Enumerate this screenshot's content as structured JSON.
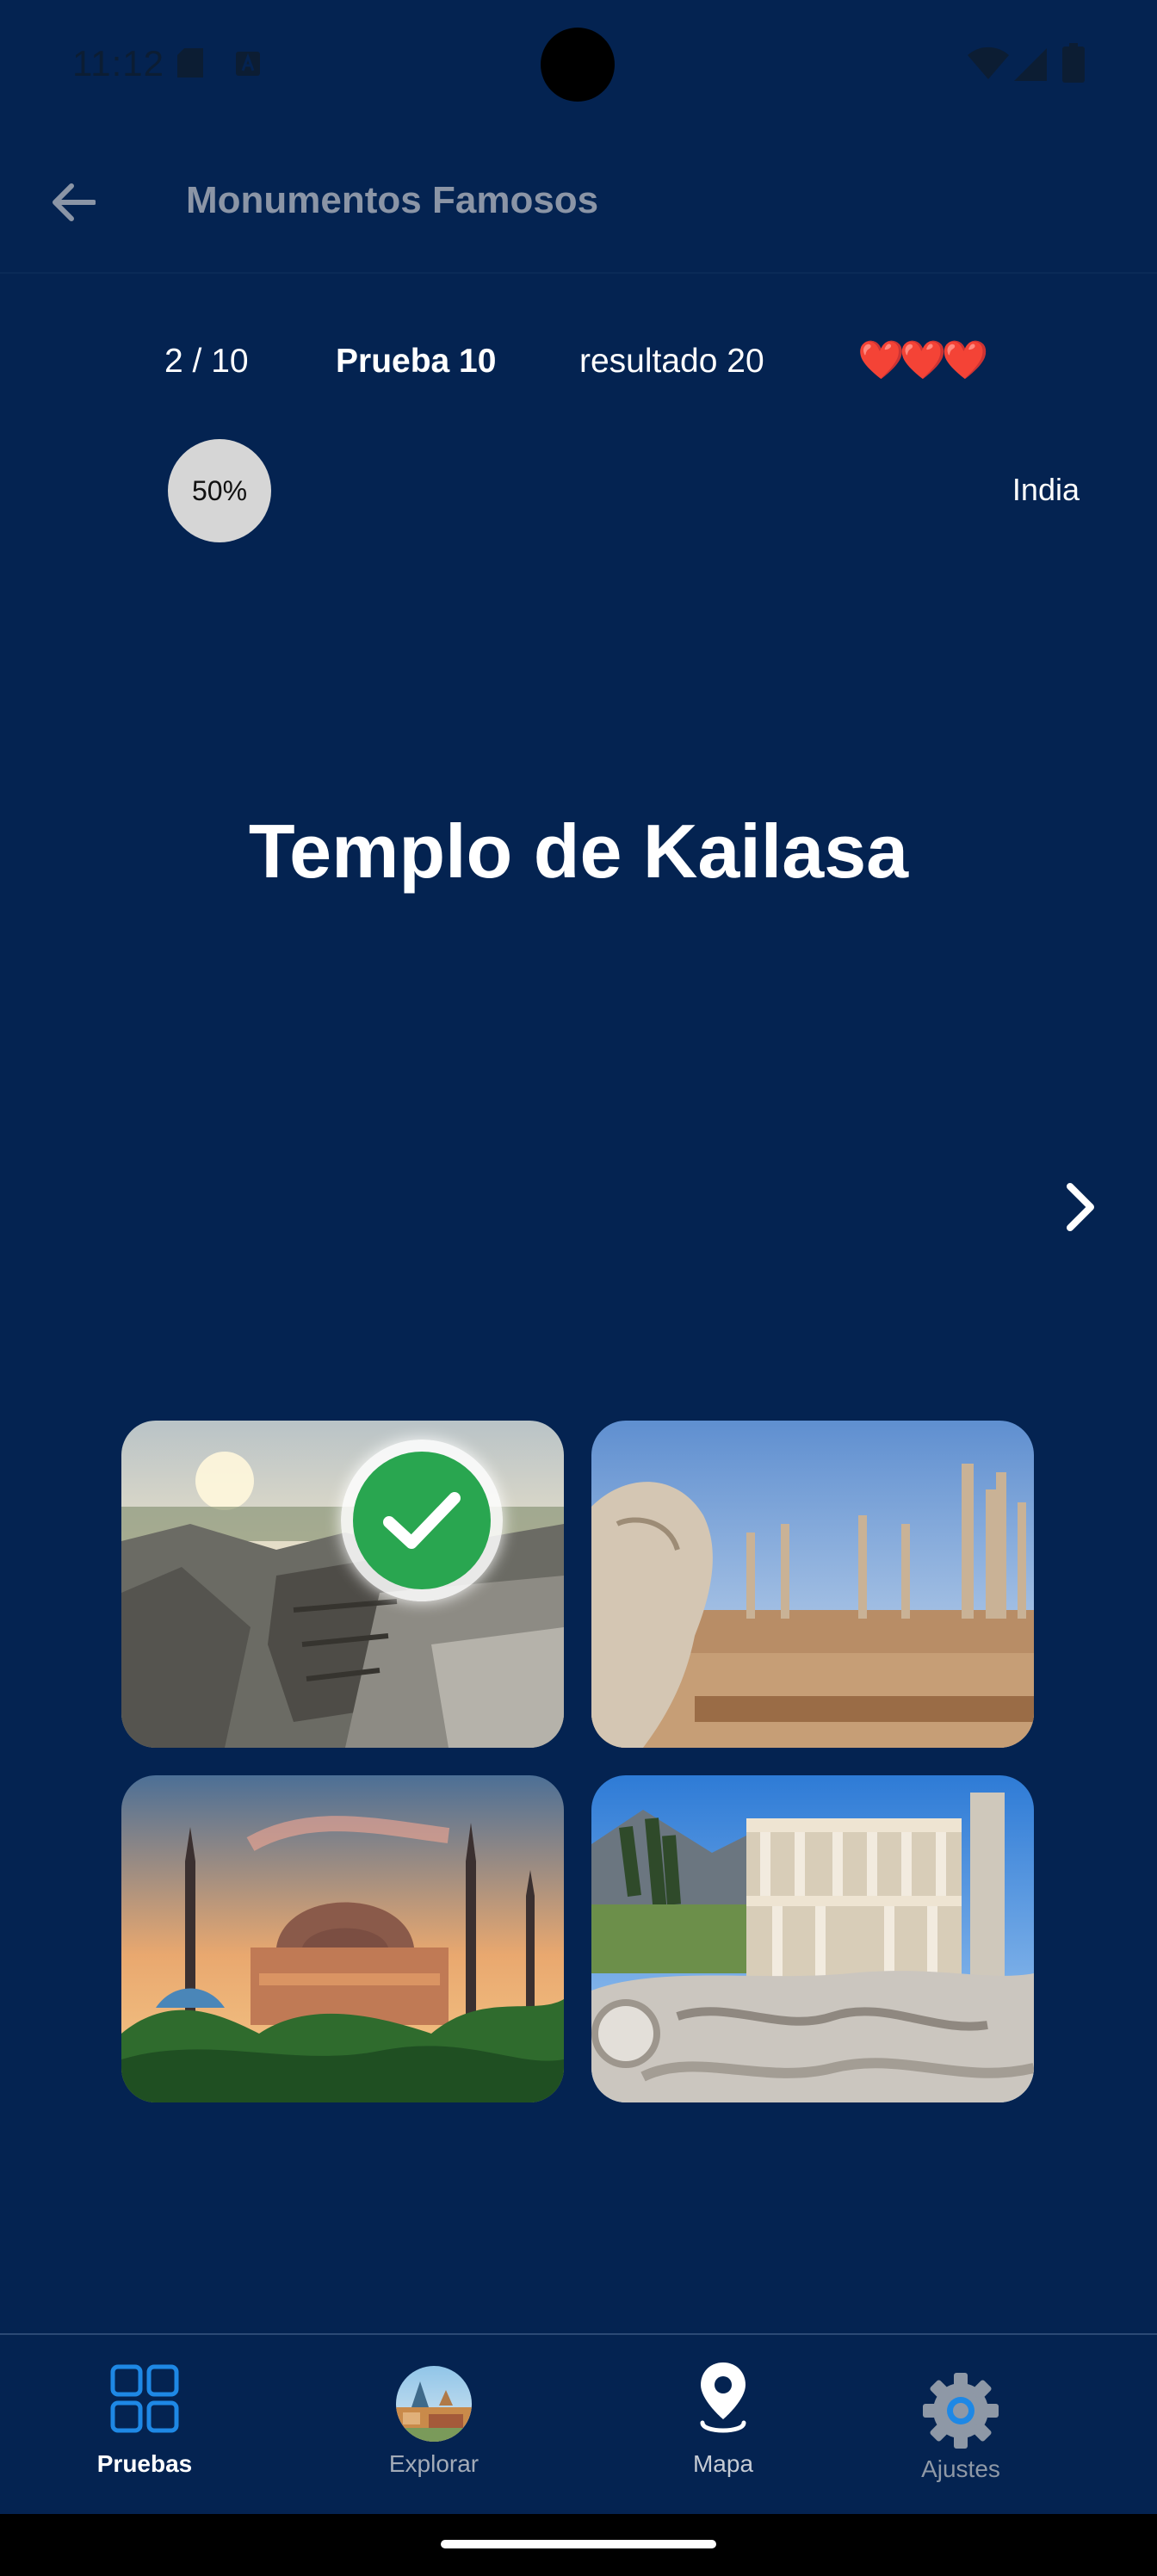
{
  "status_bar": {
    "time": "11:12"
  },
  "app_bar": {
    "title": "Monumentos Famosos"
  },
  "stats": {
    "progress": "2 / 10",
    "test": "Prueba 10",
    "result": "resultado 20",
    "lives": "❤️❤️❤️"
  },
  "percent_badge": "50%",
  "country": "India",
  "question": "Templo de Kailasa",
  "answers": [
    {
      "name": "kailasa-temple-photo",
      "selected_correct": true
    },
    {
      "name": "persepolis-photo",
      "selected_correct": false
    },
    {
      "name": "hagia-sophia-photo",
      "selected_correct": false
    },
    {
      "name": "ephesus-library-photo",
      "selected_correct": false
    }
  ],
  "nav": {
    "items": [
      {
        "label": "Pruebas",
        "icon": "grid-icon",
        "active": true
      },
      {
        "label": "Explorar",
        "icon": "globe-landmarks-icon",
        "active": false
      },
      {
        "label": "Mapa",
        "icon": "map-pin-icon",
        "active": false
      },
      {
        "label": "Ajustes",
        "icon": "gear-icon",
        "active": false
      }
    ]
  },
  "colors": {
    "background": "#042351",
    "active_nav": "#1e88e5",
    "correct": "#29a650"
  }
}
